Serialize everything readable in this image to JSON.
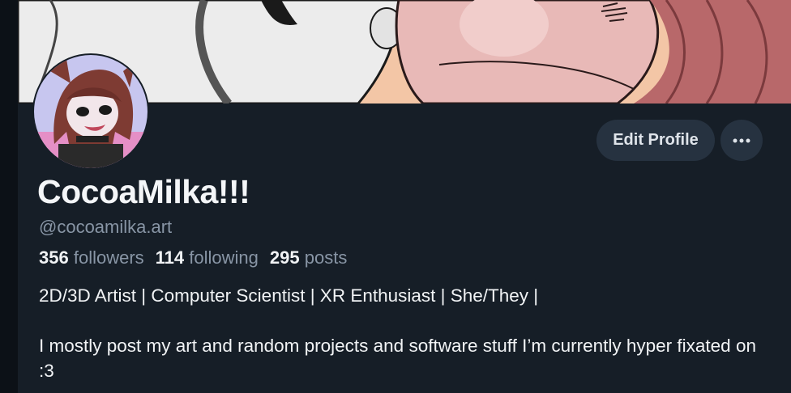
{
  "profile": {
    "display_name": "CocoaMilka!!!",
    "handle": "@cocoamilka.art",
    "stats": {
      "followers_count": "356",
      "followers_label": "followers",
      "following_count": "114",
      "following_label": "following",
      "posts_count": "295",
      "posts_label": "posts"
    },
    "bio_line1": "2D/3D Artist | Computer Scientist | XR Enthusiast | She/They |",
    "bio_line2": "I mostly post my art and random projects and software stuff I’m currently hyper fixated on :3"
  },
  "actions": {
    "edit_label": "Edit Profile",
    "more_icon": "ellipsis-icon"
  },
  "colors": {
    "background": "#161e27",
    "button_bg": "#263240",
    "muted_text": "#8895a5",
    "primary_text": "#f1f3f5"
  }
}
